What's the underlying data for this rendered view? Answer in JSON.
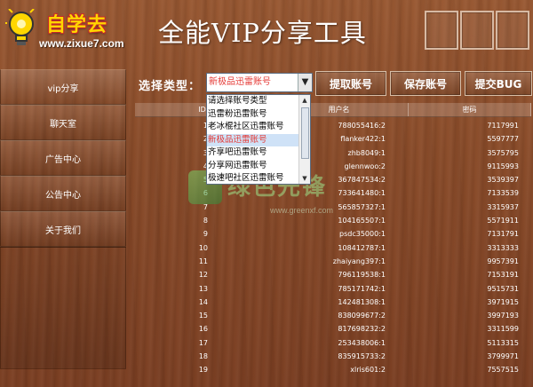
{
  "logo": {
    "name": "自学去",
    "url": "www.zixue7.com"
  },
  "app": {
    "title": "全能VIP分享工具"
  },
  "sidebar": {
    "items": [
      {
        "label": "vip分享"
      },
      {
        "label": "聊天室"
      },
      {
        "label": "广告中心"
      },
      {
        "label": "公告中心"
      },
      {
        "label": "关于我们"
      }
    ]
  },
  "toolbar": {
    "type_label": "选择类型：",
    "selected": "新极品迅雷账号",
    "fetch_label": "提取账号",
    "save_label": "保存账号",
    "bug_label": "提交BUG"
  },
  "dropdown": {
    "options": [
      "请选择账号类型",
      "迅雷粉迅雷账号",
      "老冰棍社区迅雷账号",
      "新极品迅雷账号",
      "齐享吧迅雷账号",
      "分享网迅雷账号",
      "极速吧社区迅雷账号"
    ],
    "selected_index": 3
  },
  "table": {
    "columns": [
      "ID",
      "用户名",
      "密码"
    ],
    "rows": [
      {
        "id": "1",
        "user": "788055416:2",
        "pwd": "7117991"
      },
      {
        "id": "2",
        "user": "flanker422:1",
        "pwd": "5597777"
      },
      {
        "id": "3",
        "user": "zhb8049:1",
        "pwd": "3575795"
      },
      {
        "id": "4",
        "user": "glennwoo:2",
        "pwd": "9115993"
      },
      {
        "id": "5",
        "user": "367847534:2",
        "pwd": "3539397"
      },
      {
        "id": "6",
        "user": "733641480:1",
        "pwd": "7133539"
      },
      {
        "id": "7",
        "user": "565857327:1",
        "pwd": "3315937"
      },
      {
        "id": "8",
        "user": "104165507:1",
        "pwd": "5571911"
      },
      {
        "id": "9",
        "user": "psdc35000:1",
        "pwd": "7131791"
      },
      {
        "id": "10",
        "user": "108412787:1",
        "pwd": "3313333"
      },
      {
        "id": "11",
        "user": "zhaiyang397:1",
        "pwd": "9957391"
      },
      {
        "id": "12",
        "user": "796119538:1",
        "pwd": "7153191"
      },
      {
        "id": "13",
        "user": "785171742:1",
        "pwd": "9515731"
      },
      {
        "id": "14",
        "user": "142481308:1",
        "pwd": "3971915"
      },
      {
        "id": "15",
        "user": "838099677:2",
        "pwd": "3997193"
      },
      {
        "id": "16",
        "user": "817698232:2",
        "pwd": "3311599"
      },
      {
        "id": "17",
        "user": "253438006:1",
        "pwd": "5113315"
      },
      {
        "id": "18",
        "user": "835915733:2",
        "pwd": "3799971"
      },
      {
        "id": "19",
        "user": "xlris601:2",
        "pwd": "7557515"
      }
    ]
  },
  "watermark": {
    "text": "绿色先锋",
    "url": "www.greenxf.com"
  },
  "colors": {
    "selected_text": "#e53935",
    "wood": "#8b4d2b",
    "logo_yellow": "#ffd600"
  }
}
